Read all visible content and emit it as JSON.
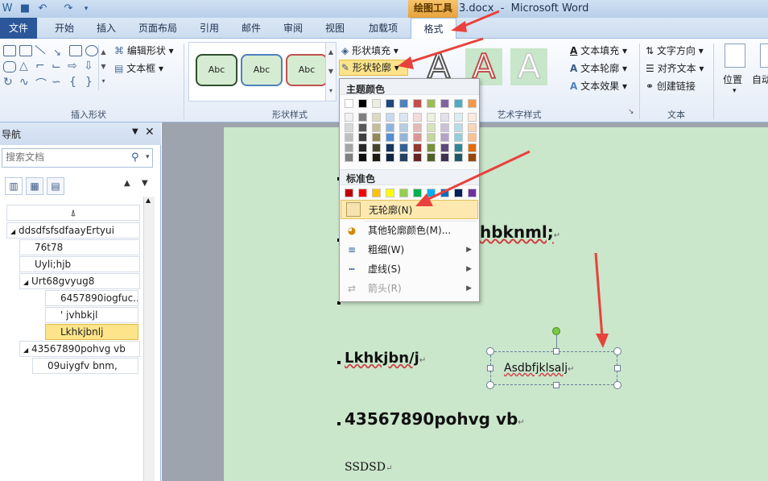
{
  "titlebar": {
    "title": "3.docx  -  Microsoft Word",
    "drawing_tools": "绘图工具"
  },
  "tabs": [
    "文件",
    "开始",
    "插入",
    "页面布局",
    "引用",
    "邮件",
    "审阅",
    "视图",
    "加载项",
    "格式"
  ],
  "ribbon": {
    "insert_shapes": {
      "label": "插入形状",
      "edit_shape": "编辑形状",
      "text_box": "文本框"
    },
    "shape_styles": {
      "label": "形状样式",
      "fill": "形状填充",
      "outline": "形状轮廓",
      "abc": "Abc"
    },
    "wordart": {
      "label": "艺术字样式",
      "text_fill": "文本填充",
      "text_outline": "文本轮廓",
      "text_effects": "文本效果",
      "letter": "A"
    },
    "text": {
      "label": "文本",
      "direction": "文字方向",
      "align": "对齐文本",
      "link": "创建链接"
    },
    "arrange": {
      "position": "位置",
      "auto_wrap": "自动"
    }
  },
  "nav": {
    "title": "导航",
    "search_placeholder": "搜索文档",
    "tree": [
      {
        "label": "ddsdfsfsdfaayErtyui",
        "level": 0,
        "expanded": true,
        "selected": false
      },
      {
        "label": "76t78",
        "level": 1,
        "selected": false
      },
      {
        "label": "Uyli;hjb",
        "level": 1,
        "selected": false
      },
      {
        "label": "Urt68gvyug8",
        "level": 1,
        "expanded": true,
        "selected": false
      },
      {
        "label": "6457890iogfuc...",
        "level": 2,
        "selected": false
      },
      {
        "label": "jvhbkjl",
        "level": 2,
        "selected": false
      },
      {
        "label": "Lkhkjbnlj",
        "level": 2,
        "selected": true
      },
      {
        "label": "43567890pohvg vb",
        "level": 0,
        "expanded": true,
        "selected": false
      },
      {
        "label": "09uiygfv bnm,",
        "level": 1,
        "selected": false
      }
    ]
  },
  "document": {
    "line1": "hbknml;",
    "line2": "Lkhkjbn/j",
    "line3": "43567890pohvg vb",
    "line4": "SSDSD",
    "textbox": "Asdbfjklsalj"
  },
  "menu": {
    "theme_colors_label": "主题颜色",
    "standard_colors_label": "标准色",
    "no_outline": "无轮廓(N)",
    "more_colors": "其他轮廓颜色(M)...",
    "weight": "粗细(W)",
    "dashes": "虚线(S)",
    "arrows": "箭头(R)",
    "theme_top": [
      "#ffffff",
      "#000000",
      "#eeece1",
      "#1f497d",
      "#4f81bd",
      "#c0504d",
      "#9bbb59",
      "#8064a2",
      "#4bacc6",
      "#f79646"
    ],
    "theme_columns": [
      [
        "#f2f2f2",
        "#d8d8d8",
        "#bfbfbf",
        "#a5a5a5",
        "#7f7f7f"
      ],
      [
        "#7f7f7f",
        "#595959",
        "#3f3f3f",
        "#262626",
        "#0c0c0c"
      ],
      [
        "#ddd9c3",
        "#c4bd97",
        "#938953",
        "#494429",
        "#1d1b10"
      ],
      [
        "#c6d9f0",
        "#8db3e2",
        "#548dd4",
        "#17365d",
        "#0f243e"
      ],
      [
        "#dbe5f1",
        "#b8cce4",
        "#95b3d7",
        "#366092",
        "#244061"
      ],
      [
        "#f2dcdb",
        "#e5b9b7",
        "#d99694",
        "#953734",
        "#632423"
      ],
      [
        "#ebf1dd",
        "#d7e3bc",
        "#c3d69b",
        "#76923c",
        "#4f6128"
      ],
      [
        "#e5e0ec",
        "#ccc1d9",
        "#b2a2c7",
        "#5f497a",
        "#3f3151"
      ],
      [
        "#dbeef3",
        "#b7dde8",
        "#92cddc",
        "#31859b",
        "#205867"
      ],
      [
        "#fdeada",
        "#fbd5b5",
        "#fac08f",
        "#e36c09",
        "#974806"
      ]
    ],
    "standard": [
      "#c00000",
      "#ff0000",
      "#ffc000",
      "#ffff00",
      "#92d050",
      "#00b050",
      "#00b0f0",
      "#0070c0",
      "#002060",
      "#7030a0"
    ]
  },
  "colors": {
    "accent": "#2b579a",
    "page_background": "#cae6cb",
    "annotation_arrow": "#e8423c",
    "highlight": "#fde48a"
  }
}
